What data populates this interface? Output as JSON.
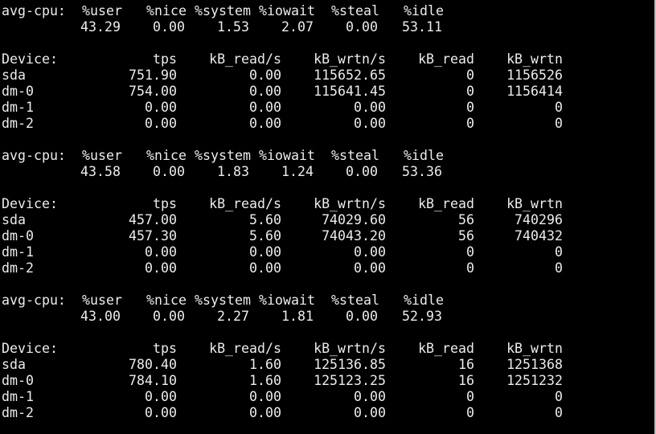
{
  "terminal": {
    "reports": [
      {
        "cpu_header": [
          "avg-cpu:",
          "%user",
          "%nice",
          "%system",
          "%iowait",
          "%steal",
          "%idle"
        ],
        "cpu_values": [
          "",
          "43.29",
          "0.00",
          "1.53",
          "2.07",
          "0.00",
          "53.11"
        ],
        "device_header": [
          "Device:",
          "tps",
          "kB_read/s",
          "kB_wrtn/s",
          "kB_read",
          "kB_wrtn"
        ],
        "devices": [
          [
            "sda",
            "751.90",
            "0.00",
            "115652.65",
            "0",
            "1156526"
          ],
          [
            "dm-0",
            "754.00",
            "0.00",
            "115641.45",
            "0",
            "1156414"
          ],
          [
            "dm-1",
            "0.00",
            "0.00",
            "0.00",
            "0",
            "0"
          ],
          [
            "dm-2",
            "0.00",
            "0.00",
            "0.00",
            "0",
            "0"
          ]
        ]
      },
      {
        "cpu_header": [
          "avg-cpu:",
          "%user",
          "%nice",
          "%system",
          "%iowait",
          "%steal",
          "%idle"
        ],
        "cpu_values": [
          "",
          "43.58",
          "0.00",
          "1.83",
          "1.24",
          "0.00",
          "53.36"
        ],
        "device_header": [
          "Device:",
          "tps",
          "kB_read/s",
          "kB_wrtn/s",
          "kB_read",
          "kB_wrtn"
        ],
        "devices": [
          [
            "sda",
            "457.00",
            "5.60",
            "74029.60",
            "56",
            "740296"
          ],
          [
            "dm-0",
            "457.30",
            "5.60",
            "74043.20",
            "56",
            "740432"
          ],
          [
            "dm-1",
            "0.00",
            "0.00",
            "0.00",
            "0",
            "0"
          ],
          [
            "dm-2",
            "0.00",
            "0.00",
            "0.00",
            "0",
            "0"
          ]
        ]
      },
      {
        "cpu_header": [
          "avg-cpu:",
          "%user",
          "%nice",
          "%system",
          "%iowait",
          "%steal",
          "%idle"
        ],
        "cpu_values": [
          "",
          "43.00",
          "0.00",
          "2.27",
          "1.81",
          "0.00",
          "52.93"
        ],
        "device_header": [
          "Device:",
          "tps",
          "kB_read/s",
          "kB_wrtn/s",
          "kB_read",
          "kB_wrtn"
        ],
        "devices": [
          [
            "sda",
            "780.40",
            "1.60",
            "125136.85",
            "16",
            "1251368"
          ],
          [
            "dm-0",
            "784.10",
            "1.60",
            "125123.25",
            "16",
            "1251232"
          ],
          [
            "dm-1",
            "0.00",
            "0.00",
            "0.00",
            "0",
            "0"
          ],
          [
            "dm-2",
            "0.00",
            "0.00",
            "0.00",
            "0",
            "0"
          ]
        ]
      }
    ]
  }
}
